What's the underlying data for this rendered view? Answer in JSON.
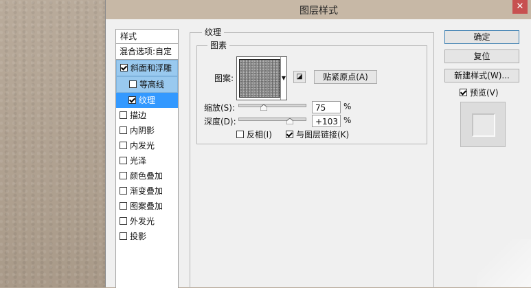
{
  "window": {
    "title": "图层样式",
    "close_glyph": "✕"
  },
  "styles_panel": {
    "header": "样式",
    "blend_options": "混合选项:自定",
    "items": [
      {
        "label": "斜面和浮雕",
        "checked": true
      },
      {
        "label": "等高线",
        "checked": false
      },
      {
        "label": "纹理",
        "checked": true
      },
      {
        "label": "描边",
        "checked": false
      },
      {
        "label": "内阴影",
        "checked": false
      },
      {
        "label": "内发光",
        "checked": false
      },
      {
        "label": "光泽",
        "checked": false
      },
      {
        "label": "颜色叠加",
        "checked": false
      },
      {
        "label": "渐变叠加",
        "checked": false
      },
      {
        "label": "图案叠加",
        "checked": false
      },
      {
        "label": "外发光",
        "checked": false
      },
      {
        "label": "投影",
        "checked": false
      }
    ]
  },
  "texture": {
    "group_title": "纹理",
    "elements_title": "图素",
    "pattern_label": "图案:",
    "snap_button": "贴紧原点(A)",
    "scale_label": "缩放(S):",
    "scale_value": "75",
    "scale_unit": "%",
    "depth_label": "深度(D):",
    "depth_value": "+103",
    "depth_unit": "%",
    "invert_label": "反相(I)",
    "invert_checked": false,
    "link_label": "与图层链接(K)",
    "link_checked": true
  },
  "actions": {
    "ok": "确定",
    "reset": "复位",
    "new_style": "新建样式(W)...",
    "preview_label": "预览(V)",
    "preview_checked": true
  }
}
